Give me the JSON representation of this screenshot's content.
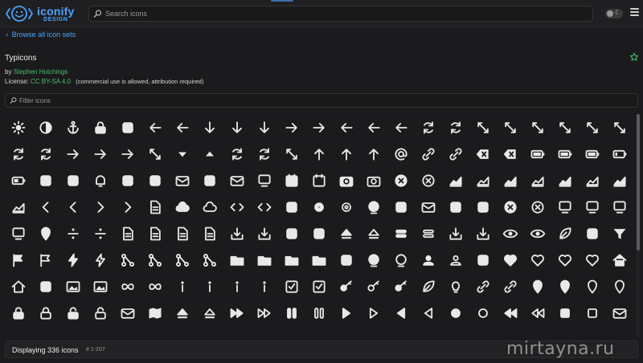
{
  "header": {
    "logo_word": "iconify",
    "logo_sub": "DESIGN",
    "search_placeholder": "Search icons",
    "theme_glyph": "☾"
  },
  "nav": {
    "browse_label": "Browse all icon sets"
  },
  "iconset": {
    "name": "Typicons",
    "by_prefix": "by",
    "author": "Stephen Hutchings",
    "license_prefix": "License:",
    "license_name": "CC BY-SA 4.0",
    "license_note": "(commercial use is allowed, attribution required)"
  },
  "filter": {
    "placeholder": "Filter icons"
  },
  "footer": {
    "count_text": "Displaying 336 icons",
    "range_text": "# 1-207"
  },
  "watermark": "mirtayna.ru",
  "colors": {
    "accent": "#4aa3ff",
    "link_green": "#4ac06a",
    "background": "#1b1b1d",
    "icon": "#e8e8e8"
  },
  "icons": [
    "sun",
    "contrast",
    "anchor",
    "lock-badge",
    "archive",
    "arrow-back",
    "arrow-back-outline",
    "arrow-down",
    "arrow-down-outline",
    "arrow-down-thick",
    "arrow-forward",
    "arrow-forward-outline",
    "arrow-left",
    "arrow-left-outline",
    "arrow-left-thick",
    "arrow-loop",
    "arrow-loop-outline",
    "arrow-maximise",
    "arrow-maximise-outline",
    "arrow-minimise",
    "arrow-minimise-outline",
    "arrow-move",
    "arrow-move-outline",
    "arrow-repeat",
    "arrow-repeat-outline",
    "arrow-right",
    "arrow-right-outline",
    "arrow-right-thick",
    "arrow-shuffle",
    "arrow-sorted-down",
    "arrow-sorted-up",
    "arrow-sync",
    "arrow-sync-outline",
    "arrow-unsorted",
    "arrow-up",
    "arrow-up-outline",
    "arrow-up-thick",
    "at",
    "attachment",
    "attachment-outline",
    "backspace",
    "backspace-outline",
    "battery-charge",
    "battery-full",
    "battery-high",
    "battery-low",
    "battery-mid",
    "beaker",
    "beer",
    "bell",
    "book",
    "bookmark",
    "briefcase",
    "brush",
    "business-card",
    "calculator",
    "calendar",
    "calendar-outline",
    "camera",
    "camera-outline",
    "cancel",
    "cancel-outline",
    "chart-area",
    "chart-area-outline",
    "chart-bar",
    "chart-bar-outline",
    "chart-line",
    "chart-line-outline",
    "chart-pie",
    "chart-pie-outline",
    "chevron-left",
    "chevron-left-outline",
    "chevron-right",
    "chevron-right-outline",
    "clipboard",
    "cloud-storage",
    "cloud-storage-outline",
    "code",
    "code-outline",
    "coffee",
    "cog",
    "cog-outline",
    "compass",
    "contacts",
    "credit-card",
    "css3",
    "database",
    "delete",
    "delete-outline",
    "device-desktop",
    "device-laptop",
    "device-phone",
    "device-tablet",
    "directions",
    "divide",
    "divide-outline",
    "document",
    "document-add",
    "document-delete",
    "document-text",
    "download",
    "download-outline",
    "dropbox",
    "edit",
    "eject",
    "eject-outline",
    "equals",
    "equals-outline",
    "export",
    "export-outline",
    "eye",
    "eye-outline",
    "feather",
    "film",
    "filter",
    "flag",
    "flag-outline",
    "flash",
    "flash-outline",
    "flow-children",
    "flow-merge",
    "flow-parallel",
    "flow-switch",
    "folder",
    "folder-add",
    "folder-delete",
    "folder-open",
    "gift",
    "globe",
    "globe-outline",
    "group",
    "group-outline",
    "headphones",
    "heart",
    "heart-full-outline",
    "heart-half-outline",
    "heart-outline",
    "home",
    "home-outline",
    "html5",
    "image",
    "image-outline",
    "infinity",
    "infinity-outline",
    "info",
    "info-large",
    "info-large-outline",
    "info-outline",
    "input-checked",
    "input-checked-outline",
    "key",
    "key-outline",
    "keyboard",
    "leaf",
    "lightbulb",
    "link",
    "link-outline",
    "location",
    "location-arrow",
    "location-arrow-outline",
    "location-outline",
    "lock-closed",
    "lock-closed-outline",
    "lock-open",
    "lock-open-outline",
    "mail",
    "map",
    "media-eject",
    "media-eject-outline",
    "media-fast-forward",
    "media-fast-forward-outline",
    "media-pause",
    "media-pause-outline",
    "media-play",
    "media-play-outline",
    "media-play-reverse",
    "media-play-reverse-outline",
    "media-record",
    "media-record-outline",
    "media-rewind",
    "media-rewind-outline",
    "media-stop",
    "media-stop-outline",
    "message"
  ]
}
